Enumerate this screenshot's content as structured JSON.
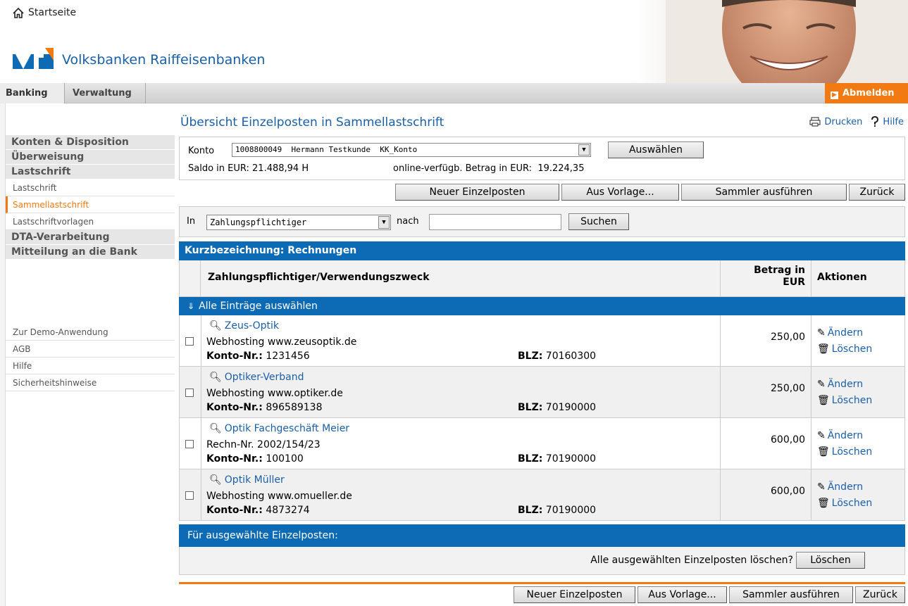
{
  "header": {
    "home_label": "Startseite",
    "bank_name": "Volksbanken Raiffeisenbanken"
  },
  "tabs": [
    {
      "label": "Banking"
    },
    {
      "label": "Verwaltung"
    }
  ],
  "logout_label": "Abmelden",
  "sidebar": {
    "items": [
      {
        "label": "Konten & Disposition"
      },
      {
        "label": "Überweisung"
      },
      {
        "label": "Lastschrift"
      },
      {
        "label": "Lastschrift"
      },
      {
        "label": "Sammellastschrift"
      },
      {
        "label": "Lastschriftvorlagen"
      },
      {
        "label": "DTA-Verarbeitung"
      },
      {
        "label": "Mitteilung an die Bank"
      }
    ],
    "lower_items": [
      {
        "label": "Zur Demo-Anwendung"
      },
      {
        "label": "AGB"
      },
      {
        "label": "Hilfe"
      },
      {
        "label": "Sicherheitshinweise"
      }
    ]
  },
  "page": {
    "title": "Übersicht Einzelposten in Sammellastschrift",
    "print_label": "Drucken",
    "help_label": "Hilfe"
  },
  "account": {
    "label": "Konto",
    "selected": "1008800049  Hermann Testkunde  KK_Konto",
    "select_button": "Auswählen",
    "saldo": "Saldo in EUR: 21.488,94 H",
    "available": "online-verfügb. Betrag in EUR:  19.224,35"
  },
  "actions": {
    "new_item": "Neuer Einzelposten",
    "from_template": "Aus Vorlage...",
    "execute": "Sammler ausführen",
    "back": "Zurück"
  },
  "search": {
    "in_label": "In",
    "field_selected": "Zahlungspflichtiger",
    "nach_label": "nach",
    "value": "",
    "button": "Suchen"
  },
  "table": {
    "title": "Kurzbezeichnung: Rechnungen",
    "col_payer": "Zahlungspflichtiger/Verwendungszweck",
    "col_amount_1": "Betrag in",
    "col_amount_2": "EUR",
    "col_actions": "Aktionen",
    "select_all": "Alle Einträge auswählen",
    "konto_label": "Konto-Nr.:",
    "blz_label": "BLZ:",
    "edit_label": "Ändern",
    "delete_label": "Löschen",
    "rows": [
      {
        "name": "Zeus-Optik",
        "purpose": "Webhosting www.zeusoptik.de",
        "konto": "1231456",
        "blz": "70160300",
        "amount": "250,00"
      },
      {
        "name": "Optiker-Verband",
        "purpose": "Webhosting www.optiker.de",
        "konto": "896589138",
        "blz": "70190000",
        "amount": "250,00"
      },
      {
        "name": "Optik Fachgeschäft Meier",
        "purpose": "Rechn-Nr. 2002/154/23",
        "konto": "100100",
        "blz": "70190000",
        "amount": "600,00"
      },
      {
        "name": "Optik Müller",
        "purpose": "Webhosting www.omueller.de",
        "konto": "4873274",
        "blz": "70190000",
        "amount": "600,00"
      }
    ]
  },
  "footer": {
    "selected_label": "Für ausgewählte Einzelposten:",
    "delete_question": "Alle ausgewählten Einzelposten löschen?",
    "delete_button": "Löschen"
  },
  "colors": {
    "accent_blue": "#0d6bb5",
    "accent_orange": "#f27a12"
  }
}
